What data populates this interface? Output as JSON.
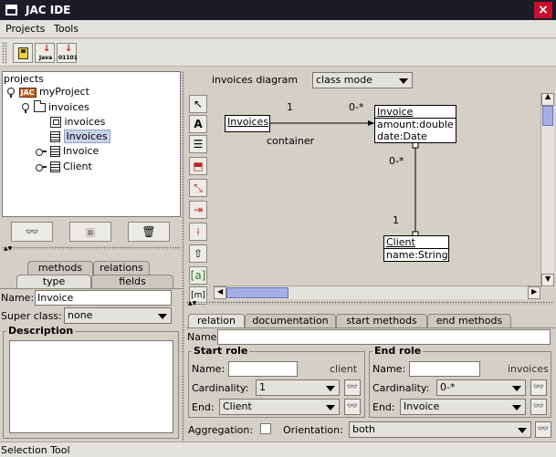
{
  "window": {
    "title": "JAC IDE",
    "close_label": "×"
  },
  "menu": {
    "items": [
      "Projects",
      "Tools"
    ]
  },
  "toolbar": {
    "buttons": [
      {
        "name": "save",
        "sub": ""
      },
      {
        "name": "gen-java",
        "sub": "Java"
      },
      {
        "name": "gen-bytecode",
        "sub": "01101"
      }
    ]
  },
  "tree": {
    "root_label": "projects",
    "project": "myProject",
    "package": "invoices",
    "items": [
      "invoices",
      "Invoices",
      "Invoice",
      "Client"
    ],
    "selected": "Invoices"
  },
  "tree_buttons": [
    "search",
    "add",
    "delete"
  ],
  "left_tabs": {
    "row1": [
      "methods",
      "relations"
    ],
    "row2": [
      "type",
      "fields"
    ],
    "active": "type"
  },
  "class_form": {
    "name_label": "Name:",
    "name_value": "Invoice",
    "super_label": "Super class:",
    "super_value": "none",
    "description_label": "Description"
  },
  "diagram": {
    "title": "invoices diagram",
    "mode": "class mode",
    "classes": [
      {
        "id": "invoices-ref",
        "name": "Invoices",
        "attrs": []
      },
      {
        "id": "invoice",
        "name": "Invoice",
        "attrs": [
          "amount:double",
          "date:Date"
        ]
      },
      {
        "id": "client",
        "name": "Client",
        "attrs": [
          "name:String"
        ]
      }
    ],
    "labels": {
      "top_one": "1",
      "top_many": "0-*",
      "container": "container",
      "mid_many": "0-*",
      "bottom_one": "1"
    }
  },
  "relation_tabs": {
    "items": [
      "relation",
      "documentation",
      "start methods",
      "end methods"
    ],
    "active": "relation"
  },
  "relation_form": {
    "name_label": "Name:",
    "name_value": "",
    "start_role": {
      "title": "Start role",
      "name_label": "Name:",
      "name_value": "",
      "name_suffix": "client",
      "cardinality_label": "Cardinality:",
      "cardinality": "1",
      "end_label": "End:",
      "end": "Client"
    },
    "end_role": {
      "title": "End role",
      "name_label": "Name:",
      "name_value": "",
      "name_suffix": "invoices",
      "cardinality_label": "Cardinality:",
      "cardinality": "0-*",
      "end_label": "End:",
      "end": "Invoice"
    },
    "aggregation_label": "Aggregation:",
    "orientation_label": "Orientation:",
    "orientation": "both"
  },
  "status": {
    "text": "Selection Tool"
  }
}
